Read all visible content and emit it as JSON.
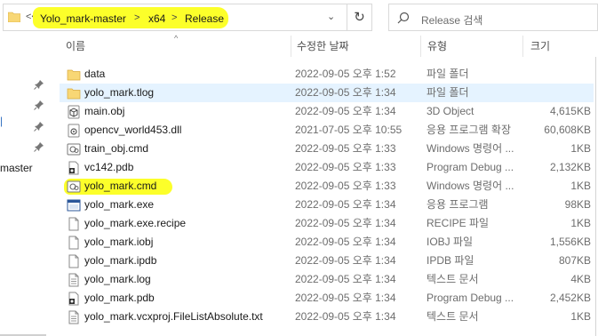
{
  "addressbar": {
    "nav_left": "<<",
    "breadcrumbs": [
      "Yolo_mark-master",
      "x64",
      "Release"
    ],
    "separator": ">",
    "dropdown": "⌄"
  },
  "refresh_glyph": "↻",
  "search": {
    "placeholder": "Release 검색"
  },
  "nav_pane": {
    "visible_text": "master",
    "blue_text": "|"
  },
  "columns": {
    "name": "이름",
    "date": "수정한 날짜",
    "type": "유형",
    "size": "크기"
  },
  "rows": [
    {
      "name": "data",
      "date": "2022-09-05 오후 1:52",
      "type": "파일 폴더",
      "size": "",
      "icon": "folder-icon"
    },
    {
      "name": "yolo_mark.tlog",
      "date": "2022-09-05 오후 1:34",
      "type": "파일 폴더",
      "size": "",
      "icon": "folder-icon"
    },
    {
      "name": "main.obj",
      "date": "2022-09-05 오후 1:34",
      "type": "3D Object",
      "size": "4,615KB",
      "icon": "3d-object-icon"
    },
    {
      "name": "opencv_world453.dll",
      "date": "2021-07-05 오후 10:55",
      "type": "응용 프로그램 확장",
      "size": "60,608KB",
      "icon": "dll-icon"
    },
    {
      "name": "train_obj.cmd",
      "date": "2022-09-05 오후 1:33",
      "type": "Windows 명령어 ...",
      "size": "1KB",
      "icon": "cmd-icon"
    },
    {
      "name": "vc142.pdb",
      "date": "2022-09-05 오후 1:33",
      "type": "Program Debug ...",
      "size": "2,132KB",
      "icon": "pdb-icon"
    },
    {
      "name": "yolo_mark.cmd",
      "date": "2022-09-05 오후 1:33",
      "type": "Windows 명령어 ...",
      "size": "1KB",
      "icon": "cmd-icon"
    },
    {
      "name": "yolo_mark.exe",
      "date": "2022-09-05 오후 1:34",
      "type": "응용 프로그램",
      "size": "98KB",
      "icon": "exe-icon"
    },
    {
      "name": "yolo_mark.exe.recipe",
      "date": "2022-09-05 오후 1:34",
      "type": "RECIPE 파일",
      "size": "1KB",
      "icon": "file-icon"
    },
    {
      "name": "yolo_mark.iobj",
      "date": "2022-09-05 오후 1:34",
      "type": "IOBJ 파일",
      "size": "1,556KB",
      "icon": "file-icon"
    },
    {
      "name": "yolo_mark.ipdb",
      "date": "2022-09-05 오후 1:34",
      "type": "IPDB 파일",
      "size": "807KB",
      "icon": "file-icon"
    },
    {
      "name": "yolo_mark.log",
      "date": "2022-09-05 오후 1:34",
      "type": "텍스트 문서",
      "size": "4KB",
      "icon": "text-file-icon"
    },
    {
      "name": "yolo_mark.pdb",
      "date": "2022-09-05 오후 1:34",
      "type": "Program Debug ...",
      "size": "2,452KB",
      "icon": "pdb-icon"
    },
    {
      "name": "yolo_mark.vcxproj.FileListAbsolute.txt",
      "date": "2022-09-05 오후 1:34",
      "type": "텍스트 문서",
      "size": "1KB",
      "icon": "text-file-icon"
    }
  ],
  "colors": {
    "highlight": "#fcff2a",
    "selection": "#e5f3ff",
    "folder": "#f8d775"
  }
}
